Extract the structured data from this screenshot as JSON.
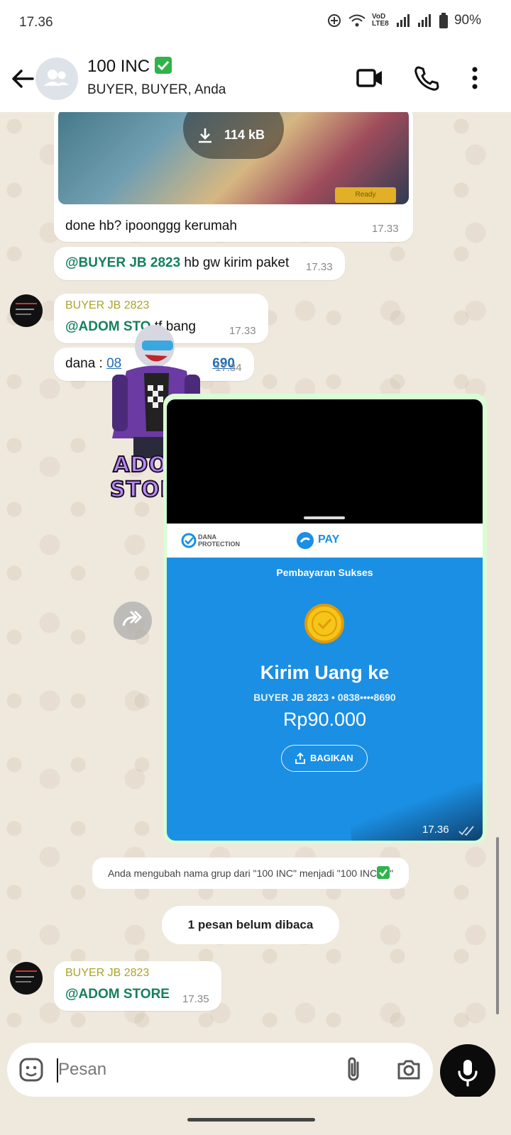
{
  "status": {
    "time": "17.36",
    "net_label": "VoD LTE8",
    "battery": "90%"
  },
  "header": {
    "title": "100 INC",
    "members": "BUYER, BUYER, Anda"
  },
  "media_top": {
    "size_label": "114 kB",
    "tag": "Ready"
  },
  "messages": [
    {
      "text": "done hb? ipoonggg kerumah",
      "time": "17.33"
    },
    {
      "mention": "@BUYER JB 2823",
      "text": " hb gw kirim paket",
      "time": "17.33"
    },
    {
      "sender": "BUYER JB 2823",
      "mention": "@ADOM STO",
      "text": " tf bang",
      "time": "17.33"
    },
    {
      "text": "dana : ",
      "link_start": "08",
      "link_end": "690",
      "time": "17.34"
    }
  ],
  "sticker": {
    "label": "ADOM STORE"
  },
  "receipt": {
    "dana_protection": "DANA PROTECTION",
    "pay_label": "PAY",
    "status": "Pembayaran Sukses",
    "headline": "Kirim Uang ke",
    "recipient": "BUYER JB 2823 • 0838••••8690",
    "amount": "Rp90.000",
    "share_label": "BAGIKAN",
    "time": "17.36"
  },
  "system_msg": {
    "text": "Anda mengubah nama grup dari \"100 INC\" menjadi \"100 INC",
    "suffix": "\""
  },
  "unread_label": "1 pesan belum dibaca",
  "last_message": {
    "sender": "BUYER JB 2823",
    "mention": "@ADOM STORE",
    "time": "17.35"
  },
  "composer": {
    "placeholder": "Pesan"
  },
  "colors": {
    "accent_green": "#14805e",
    "check_green": "#2fb34a",
    "dana_blue": "#1a8fe3",
    "sender_color": "#a8a42a"
  }
}
